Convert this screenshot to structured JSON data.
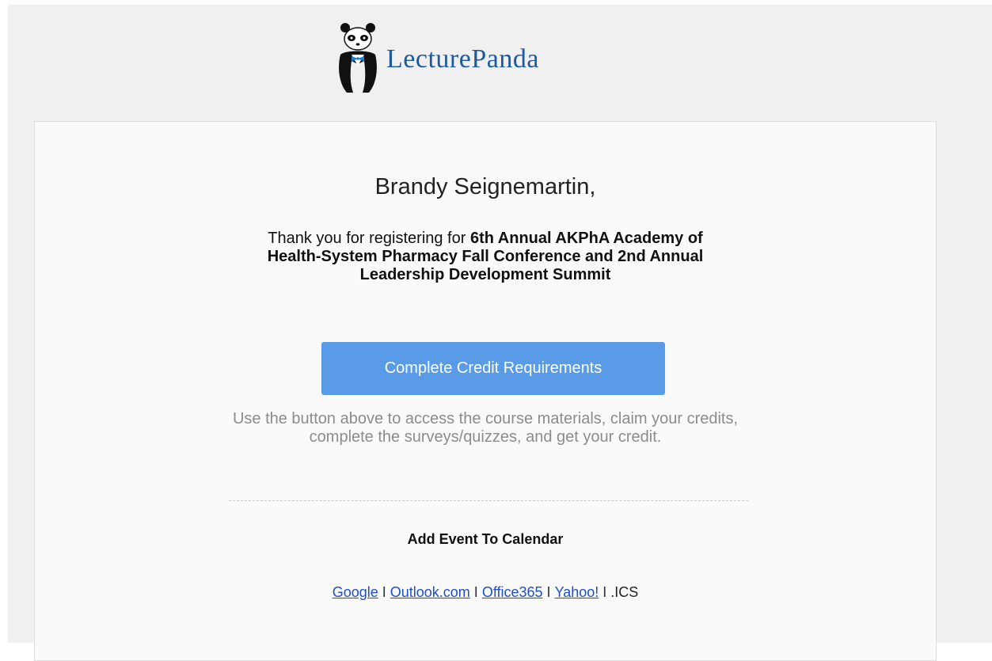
{
  "brand": {
    "name_first": "Lecture",
    "name_second": "Panda",
    "brand_color": "#1d5aa0"
  },
  "email": {
    "greeting": "Brandy Seignemartin,",
    "intro_prefix": "Thank you for registering for ",
    "event_name": "6th Annual AKPhA Academy of Health-System Pharmacy Fall Conference and 2nd Annual Leadership Development Summit",
    "cta_label": "Complete Credit Requirements",
    "cta_color": "#5a9be8",
    "helper_text": "Use the button above to access the course materials, claim your credits, complete the surveys/quizzes, and get your credit.",
    "calendar_heading": "Add Event To Calendar",
    "calendar_links": {
      "google": "Google",
      "outlook": "Outlook.com",
      "office365": "Office365",
      "yahoo": "Yahoo!",
      "ics": ".ICS"
    },
    "separator": "I"
  }
}
